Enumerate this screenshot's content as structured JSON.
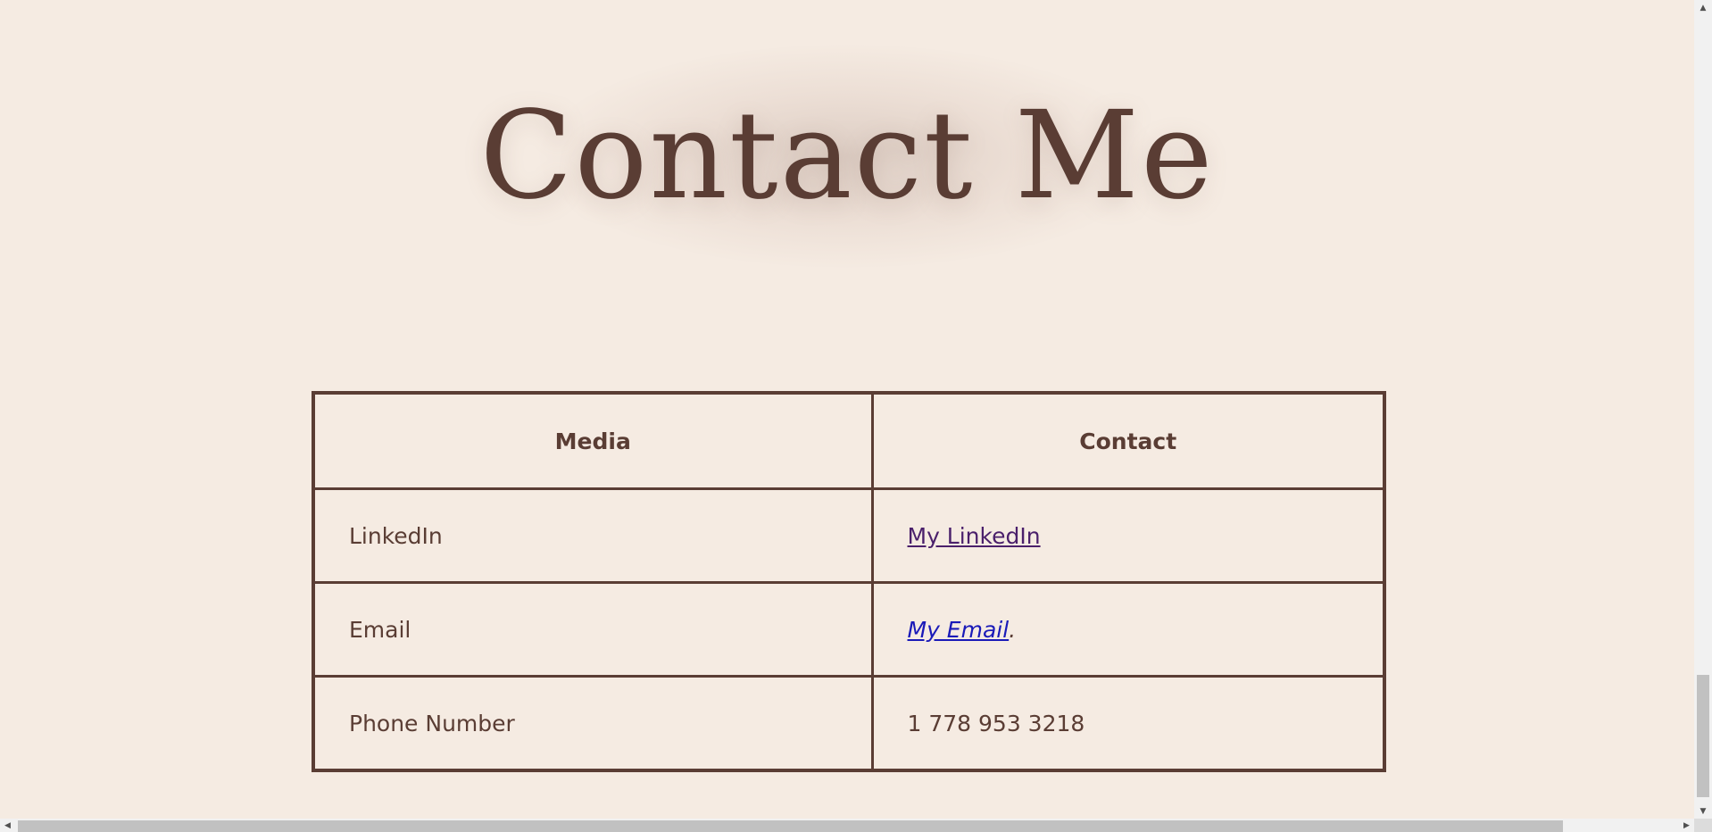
{
  "page": {
    "title": "Contact Me"
  },
  "table": {
    "headers": [
      "Media",
      "Contact"
    ],
    "rows": [
      {
        "media": "LinkedIn",
        "contact": "My LinkedIn"
      },
      {
        "media": "Email",
        "contact": "My Email",
        "contact_suffix": "."
      },
      {
        "media": "Phone Number",
        "contact": "1 778 953 3218"
      }
    ]
  },
  "colors": {
    "background": "#f5ebe2",
    "text": "#5a3d34",
    "border": "#5a3d34",
    "visited_link": "#4a1f6b",
    "link": "#1a1ab8"
  },
  "icons": {
    "scroll_up": "triangle-up-icon",
    "scroll_down": "triangle-down-icon",
    "scroll_left": "triangle-left-icon",
    "scroll_right": "triangle-right-icon"
  },
  "glyphs": {
    "up": "▲",
    "down": "▼",
    "left": "◀",
    "right": "▶"
  }
}
